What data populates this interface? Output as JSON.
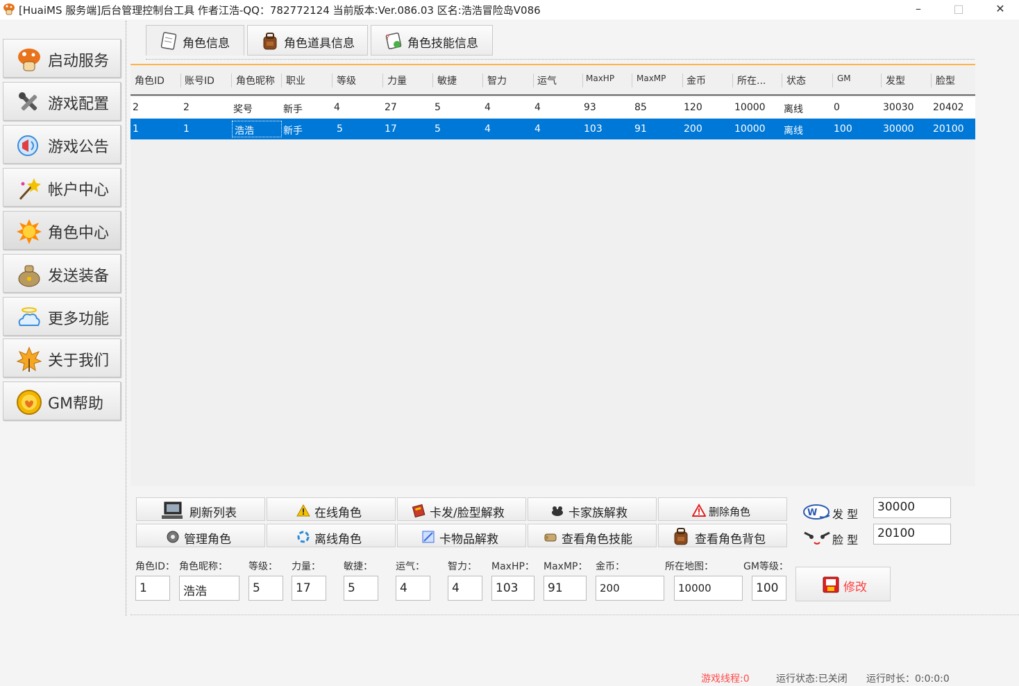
{
  "window": {
    "title": "[HuaiMS 服务端]后台管理控制台工具 作者江浩-QQ：782772124 当前版本:Ver.086.03 区名:浩浩冒险岛V086",
    "minimize": "–",
    "maximize": "□",
    "close": "✕"
  },
  "sidebar": {
    "items": [
      {
        "label": "启动服务",
        "icon": "mushroom-icon"
      },
      {
        "label": "游戏配置",
        "icon": "tools-icon"
      },
      {
        "label": "游戏公告",
        "icon": "megaphone-icon"
      },
      {
        "label": "帐户中心",
        "icon": "wand-icon"
      },
      {
        "label": "角色中心",
        "icon": "sun-icon"
      },
      {
        "label": "发送装备",
        "icon": "bag-icon"
      },
      {
        "label": "更多功能",
        "icon": "cloud-icon"
      },
      {
        "label": "关于我们",
        "icon": "leaf-icon"
      },
      {
        "label": "GM帮助",
        "icon": "coin-icon"
      }
    ]
  },
  "tabs": [
    {
      "label": "角色信息"
    },
    {
      "label": "角色道具信息"
    },
    {
      "label": "角色技能信息"
    }
  ],
  "table": {
    "columns": [
      "角色ID",
      "账号ID",
      "角色昵称",
      "职业",
      "等级",
      "力量",
      "敏捷",
      "智力",
      "运气",
      "MaxHP",
      "MaxMP",
      "金币",
      "所在...",
      "状态",
      "GM",
      "发型",
      "脸型"
    ],
    "rows": [
      [
        "2",
        "2",
        "奖号",
        "新手",
        "4",
        "27",
        "5",
        "4",
        "4",
        "93",
        "85",
        "120",
        "10000",
        "离线",
        "0",
        "30030",
        "20402"
      ],
      [
        "1",
        "1",
        "浩浩",
        "新手",
        "5",
        "17",
        "5",
        "4",
        "4",
        "103",
        "91",
        "200",
        "10000",
        "离线",
        "100",
        "30000",
        "20100"
      ]
    ]
  },
  "actions": {
    "refresh": "刷新列表",
    "online": "在线角色",
    "unstick_hair": "卡发/脸型解救",
    "unstick_family": "卡家族解救",
    "delete": "删除角色",
    "manage": "管理角色",
    "offline": "离线角色",
    "unstick_item": "卡物品解救",
    "view_skills": "查看角色技能",
    "view_bag": "查看角色背包"
  },
  "appearance": {
    "hair_label": "发 型",
    "hair_value": "30000",
    "face_label": "脸 型",
    "face_value": "20100"
  },
  "form": {
    "fields": [
      {
        "label": "角色ID：",
        "value": "1"
      },
      {
        "label": "角色昵称：",
        "value": "浩浩"
      },
      {
        "label": "等级：",
        "value": "5"
      },
      {
        "label": "力量：",
        "value": "17"
      },
      {
        "label": "敏捷：",
        "value": "5"
      },
      {
        "label": "运气：",
        "value": "4"
      },
      {
        "label": "智力：",
        "value": "4"
      },
      {
        "label": "MaxHP：",
        "value": "103"
      },
      {
        "label": "MaxMP：",
        "value": "91"
      },
      {
        "label": "金币：",
        "value": "200"
      },
      {
        "label": "所在地图：",
        "value": "10000"
      },
      {
        "label": "GM等级：",
        "value": "100"
      }
    ],
    "modify": "修改"
  },
  "status": {
    "threads": "游戏线程:0",
    "state": "运行状态:已关闭",
    "uptime": "运行时长：0:0:0:0"
  }
}
